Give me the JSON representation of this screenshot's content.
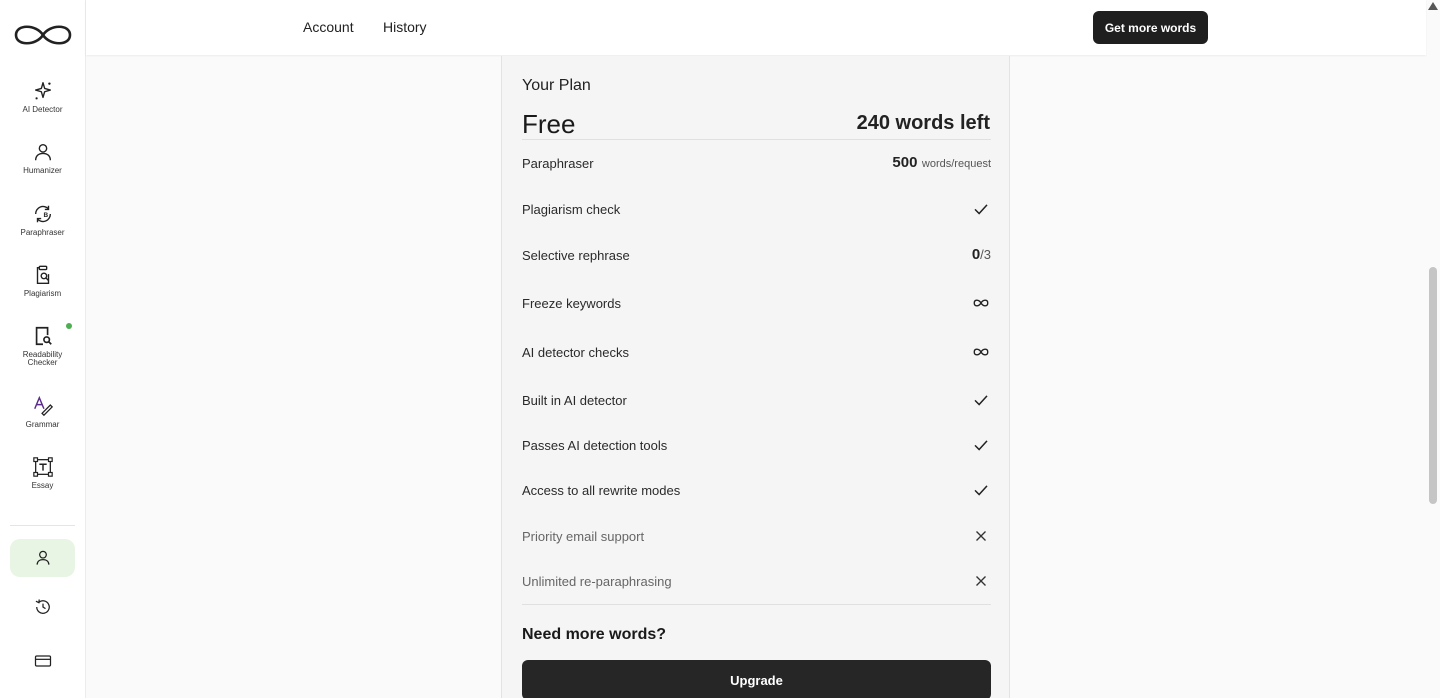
{
  "nav": {
    "items": [
      {
        "label": "AI Detector",
        "icon": "sparkle-icon"
      },
      {
        "label": "Humanizer",
        "icon": "person-icon"
      },
      {
        "label": "Paraphraser",
        "icon": "refresh-icon"
      },
      {
        "label": "Plagiarism",
        "icon": "clipboard-search-icon"
      },
      {
        "label": "Readability Checker",
        "icon": "document-search-icon"
      },
      {
        "label": "Grammar",
        "icon": "grammar-icon"
      },
      {
        "label": "Essay",
        "icon": "text-frame-icon"
      }
    ],
    "bottom": [
      {
        "icon": "account-icon",
        "active": true
      },
      {
        "icon": "history-icon",
        "active": false
      },
      {
        "icon": "card-icon",
        "active": false
      }
    ]
  },
  "topbar": {
    "links": [
      "Account",
      "History"
    ],
    "cta": "Get more words"
  },
  "plan": {
    "heading": "Your Plan",
    "name": "Free",
    "words_left": "240 words left",
    "features": [
      {
        "label": "Paraphraser",
        "kind": "value",
        "value": "500",
        "unit": "words/request"
      },
      {
        "label": "Plagiarism check",
        "kind": "check"
      },
      {
        "label": "Selective rephrase",
        "kind": "value",
        "value": "0",
        "unit": "/3"
      },
      {
        "label": "Freeze keywords",
        "kind": "infinity"
      },
      {
        "label": "AI detector checks",
        "kind": "infinity"
      },
      {
        "label": "Built in AI detector",
        "kind": "check"
      },
      {
        "label": "Passes AI detection tools",
        "kind": "check"
      },
      {
        "label": "Access to all rewrite modes",
        "kind": "check"
      },
      {
        "label": "Priority email support",
        "kind": "cross"
      },
      {
        "label": "Unlimited re-paraphrasing",
        "kind": "cross"
      }
    ],
    "need_more": "Need more words?",
    "upgrade_label": "Upgrade"
  },
  "colors": {
    "accent_green": "#4caf50",
    "active_bg": "#e8f5e4",
    "button_dark": "#1f1f1f"
  }
}
